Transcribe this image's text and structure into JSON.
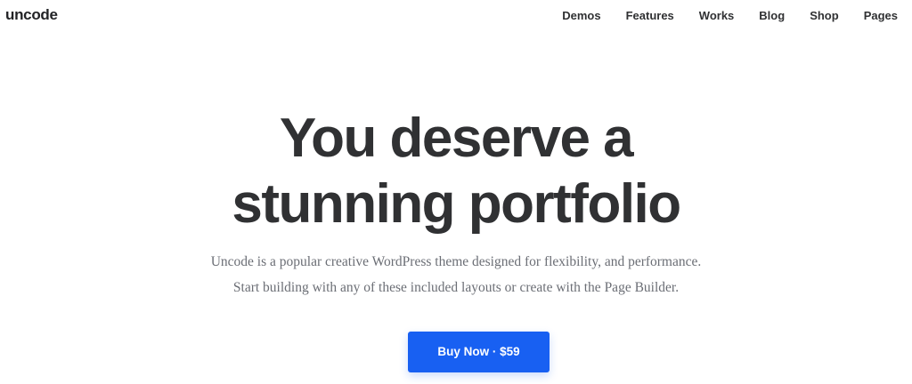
{
  "header": {
    "logo": "uncode",
    "nav": [
      "Demos",
      "Features",
      "Works",
      "Blog",
      "Shop",
      "Pages"
    ]
  },
  "hero": {
    "title_line1": "You deserve a",
    "title_line2": "stunning portfolio",
    "subtitle_line1": "Uncode is a popular creative WordPress theme designed for flexibility, and performance.",
    "subtitle_line2": "Start building with any of these included layouts or create with the Page Builder.",
    "cta_label": "Buy Now · $59"
  },
  "colors": {
    "accent": "#1860f2",
    "text": "#303133",
    "muted": "#6b6e75",
    "background": "#ffffff"
  }
}
